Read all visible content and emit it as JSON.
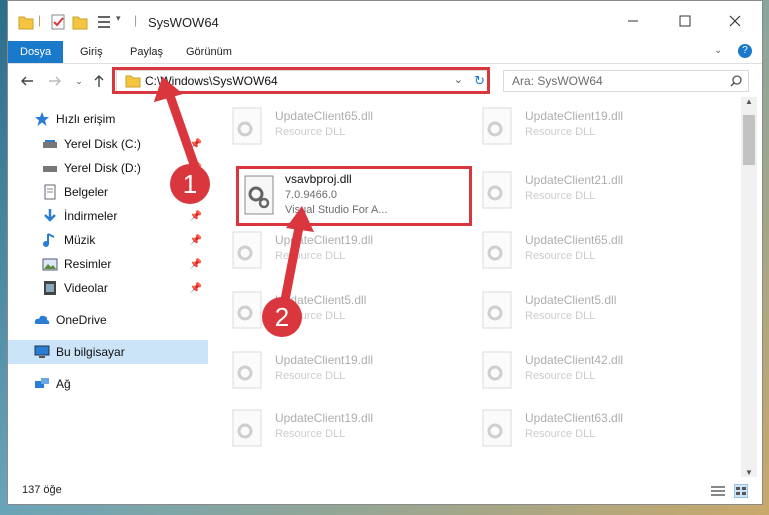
{
  "window": {
    "title": "SysWOW64"
  },
  "ribbon": {
    "tabs": [
      "Dosya",
      "Giriş",
      "Paylaş",
      "Görünüm"
    ]
  },
  "navigation": {
    "address": "C:\\Windows\\SysWOW64",
    "search_placeholder": "Ara: SysWOW64"
  },
  "sidebar": {
    "items": [
      {
        "label": "Hızlı erişim",
        "icon": "star-icon"
      },
      {
        "label": "Yerel Disk (C:)",
        "icon": "drive-icon",
        "pinned": true
      },
      {
        "label": "Yerel Disk (D:)",
        "icon": "drive-icon",
        "pinned": true
      },
      {
        "label": "Belgeler",
        "icon": "documents-icon",
        "pinned": true
      },
      {
        "label": "İndirmeler",
        "icon": "download-icon",
        "pinned": true
      },
      {
        "label": "Müzik",
        "icon": "music-icon",
        "pinned": true
      },
      {
        "label": "Resimler",
        "icon": "pictures-icon",
        "pinned": true
      },
      {
        "label": "Videolar",
        "icon": "videos-icon",
        "pinned": true
      },
      {
        "label": "OneDrive",
        "icon": "cloud-icon"
      },
      {
        "label": "Bu bilgisayar",
        "icon": "computer-icon",
        "selected": true
      },
      {
        "label": "Ağ",
        "icon": "network-icon"
      }
    ]
  },
  "files": {
    "left": [
      {
        "name": "UpdateClient65.dll",
        "type": "Resource DLL"
      },
      {
        "name": "vsavbproj.dll",
        "version": "7.0.9466.0",
        "description": "Visual Studio For A..."
      },
      {
        "name": "UpdateClient19.dll",
        "type": "Resource DLL"
      },
      {
        "name": "UpdateClient5.dll",
        "type": "Resource DLL"
      },
      {
        "name": "UpdateClient19.dll",
        "type": "Resource DLL"
      },
      {
        "name": "UpdateClient19.dll",
        "type": "Resource DLL"
      }
    ],
    "right": [
      {
        "name": "UpdateClient19.dll",
        "type": "Resource DLL"
      },
      {
        "name": "UpdateClient21.dll",
        "type": "Resource DLL"
      },
      {
        "name": "UpdateClient65.dll",
        "type": "Resource DLL"
      },
      {
        "name": "UpdateClient5.dll",
        "type": "Resource DLL"
      },
      {
        "name": "UpdateClient42.dll",
        "type": "Resource DLL"
      },
      {
        "name": "UpdateClient63.dll",
        "type": "Resource DLL"
      }
    ]
  },
  "status": {
    "item_count": "137 öğe"
  },
  "annotations": {
    "step1": "1",
    "step2": "2"
  },
  "colors": {
    "accent": "#1979ca",
    "highlight": "#d9363e",
    "selected": "#cce4f7"
  }
}
